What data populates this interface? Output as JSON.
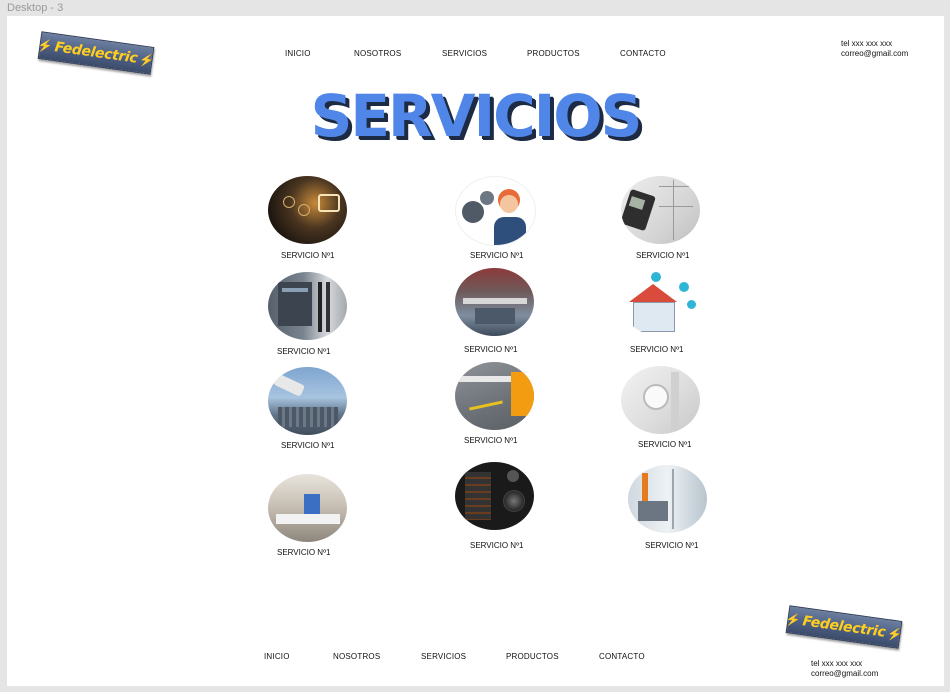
{
  "frame_label": "Desktop - 3",
  "logo": {
    "text": "Fedelectric"
  },
  "nav": [
    "INICIO",
    "NOSOTROS",
    "SERVICIOS",
    "PRODUCTOS",
    "CONTACTO"
  ],
  "contact": {
    "phone": "tel xxx xxx xxx",
    "email": "correo@gmail.com"
  },
  "page_title": "SERVICIOS",
  "services": [
    {
      "label": "SERVICIO Nº1"
    },
    {
      "label": "SERVICIO Nº1"
    },
    {
      "label": "SERVICIO Nº1"
    },
    {
      "label": "SERVICIO Nº1"
    },
    {
      "label": "SERVICIO Nº1"
    },
    {
      "label": "SERVICIO Nº1"
    },
    {
      "label": "SERVICIO Nº1"
    },
    {
      "label": "SERVICIO Nº1"
    },
    {
      "label": "SERVICIO Nº1"
    },
    {
      "label": "SERVICIO Nº1"
    },
    {
      "label": "SERVICIO Nº1"
    },
    {
      "label": "SERVICIO Nº1"
    }
  ],
  "colors": {
    "title": "#4f86e8",
    "title_shadow": "#1d2a44",
    "logo_text": "#ffcf1f",
    "logo_bg": "#4d5f83"
  }
}
